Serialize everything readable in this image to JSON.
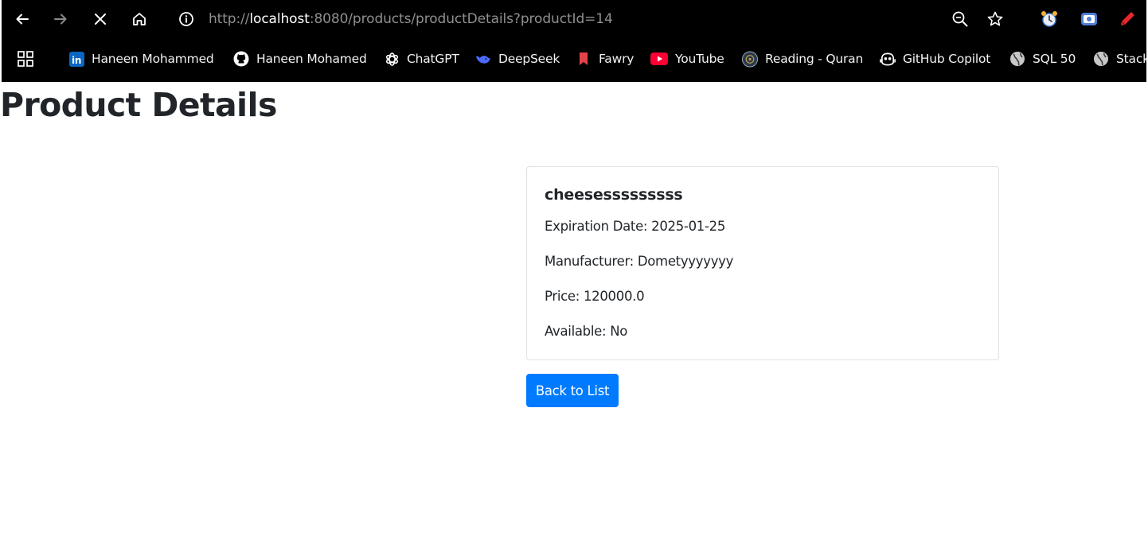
{
  "browser": {
    "url": {
      "prefix": "http://",
      "host": "localhost",
      "rest": ":8080/products/productDetails?productId=14"
    },
    "nav_icons": [
      "back-arrow-icon",
      "forward-arrow-icon",
      "stop-loading-icon",
      "home-icon",
      "site-info-icon"
    ],
    "toolbar_icons": [
      "zoom-icon",
      "bookmark-star-icon",
      "extension-alarm-icon",
      "extension-screen-icon",
      "extension-pen-icon"
    ],
    "bookmarks": [
      {
        "label": "Haneen Mohammed",
        "icon": "linkedin-icon"
      },
      {
        "label": "Haneen Mohamed",
        "icon": "github-icon"
      },
      {
        "label": "ChatGPT",
        "icon": "chatgpt-icon"
      },
      {
        "label": "DeepSeek",
        "icon": "deepseek-icon"
      },
      {
        "label": "Fawry",
        "icon": "fawry-bookmark-icon"
      },
      {
        "label": "YouTube",
        "icon": "youtube-icon"
      },
      {
        "label": "Reading - Quran",
        "icon": "quran-icon"
      },
      {
        "label": "GitHub Copilot",
        "icon": "copilot-icon"
      },
      {
        "label": "SQL 50",
        "icon": "globe-icon"
      },
      {
        "label": "Stack",
        "icon": "globe-icon"
      }
    ]
  },
  "page": {
    "title": "Product Details",
    "product": {
      "name": "cheesesssssssss",
      "expiration": "Expiration Date: 2025-01-25",
      "manufacturer": "Manufacturer: Dometyyyyyyy",
      "price": "Price: 120000.0",
      "available": "Available: No"
    },
    "back_button": "Back to List"
  },
  "colors": {
    "chrome_bg": "#000000",
    "button_primary": "#007bff",
    "text": "#212529",
    "card_border": "#dee2e6"
  }
}
